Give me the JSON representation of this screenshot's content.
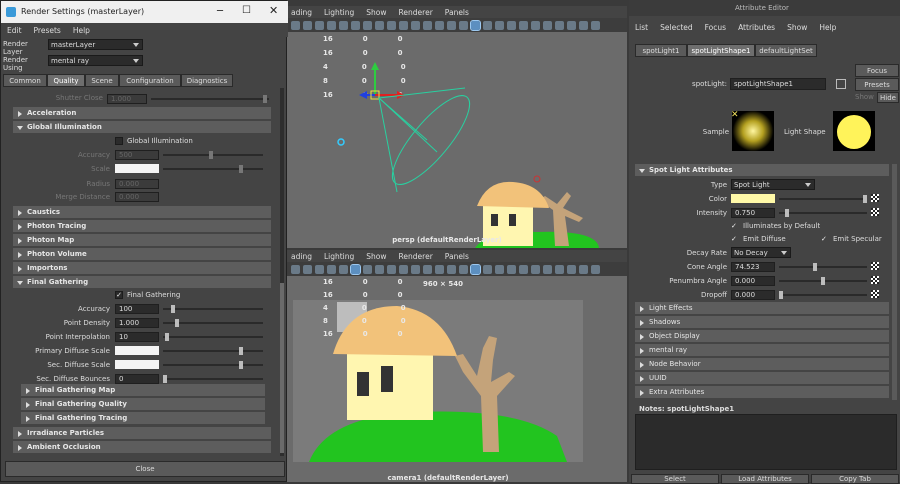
{
  "vp1": {
    "menu": [
      "ading",
      "Lighting",
      "Show",
      "Renderer",
      "Panels"
    ],
    "hud": [
      [
        "16",
        "0",
        "0"
      ],
      [
        "16",
        "0",
        "0"
      ],
      [
        "4",
        "0",
        "0"
      ],
      [
        "8",
        "0",
        "0"
      ],
      [
        "16",
        "0",
        "0"
      ]
    ],
    "camera": "persp (defaultRenderLayer)"
  },
  "vp2": {
    "menu": [
      "ading",
      "Lighting",
      "Show",
      "Renderer",
      "Panels"
    ],
    "hud": [
      [
        "16",
        "0",
        "0"
      ],
      [
        "16",
        "0",
        "0"
      ],
      [
        "4",
        "0",
        "0"
      ],
      [
        "8",
        "0",
        "0"
      ],
      [
        "16",
        "0",
        "0"
      ]
    ],
    "res": "960 × 540",
    "camera": "camera1 (defaultRenderLayer)"
  },
  "rs": {
    "title": "Render Settings (masterLayer)",
    "menu": [
      "Edit",
      "Presets",
      "Help"
    ],
    "render_layer_label": "Render Layer",
    "render_layer": "masterLayer",
    "render_using_label": "Render Using",
    "render_using": "mental ray",
    "tabs": [
      "Common",
      "Quality",
      "Scene",
      "Configuration",
      "Diagnostics"
    ],
    "shutter_close": "Shutter Close",
    "shutter_val": "1.000",
    "sections": [
      "Acceleration",
      "Global Illumination",
      "Caustics",
      "Photon Tracing",
      "Photon Map",
      "Photon Volume",
      "Importons",
      "Final Gathering",
      "Irradiance Particles",
      "Ambient Occlusion"
    ],
    "gi": {
      "checkbox": "Global Illumination",
      "accuracy": "Accuracy",
      "accuracy_val": "500",
      "scale": "Scale",
      "radius": "Radius",
      "radius_val": "0.000",
      "merge": "Merge Distance",
      "merge_val": "0.000"
    },
    "fg": {
      "checkbox": "Final Gathering",
      "check": "✓",
      "accuracy": "Accuracy",
      "accuracy_val": "100",
      "point_density": "Point Density",
      "point_density_val": "1.000",
      "point_interp": "Point Interpolation",
      "point_interp_val": "10",
      "pds": "Primary Diffuse Scale",
      "sds": "Sec. Diffuse Scale",
      "sdb": "Sec. Diffuse Bounces",
      "sdb_val": "0",
      "sub": [
        "Final Gathering Map",
        "Final Gathering Quality",
        "Final Gathering Tracing"
      ]
    },
    "close": "Close"
  },
  "ae": {
    "title": "Attribute Editor",
    "menu": [
      "List",
      "Selected",
      "Focus",
      "Attributes",
      "Show",
      "Help"
    ],
    "tabs": [
      "spotLight1",
      "spotLightShape1",
      "defaultLightSet"
    ],
    "node_label": "spotLight:",
    "node_value": "spotLightShape1",
    "focus": "Focus",
    "presets": "Presets",
    "show": "Show",
    "hide": "Hide",
    "sample": "Sample",
    "light_shape": "Light Shape",
    "section": "Spot Light Attributes",
    "type_label": "Type",
    "type": "Spot Light",
    "color_label": "Color",
    "intensity_label": "Intensity",
    "intensity": "0.750",
    "illum": "Illuminates by Default",
    "emit_diffuse": "Emit Diffuse",
    "emit_specular": "Emit Specular",
    "check": "✓",
    "decay_label": "Decay Rate",
    "decay": "No Decay",
    "cone_label": "Cone Angle",
    "cone": "74.523",
    "penumbra_label": "Penumbra Angle",
    "penumbra": "0.000",
    "dropoff_label": "Dropoff",
    "dropoff": "0.000",
    "collapsed": [
      "Light Effects",
      "Shadows",
      "Object Display",
      "mental ray",
      "Node Behavior",
      "UUID",
      "Extra Attributes"
    ],
    "notes": "Notes:  spotLightShape1",
    "buttons": [
      "Select",
      "Load Attributes",
      "Copy Tab"
    ]
  },
  "colors": {
    "light_color": "#fff9a8",
    "ground": "#22c41f",
    "trunk": "#c4a37a",
    "roof": "#f2c27a",
    "wall": "#fff6b0"
  }
}
